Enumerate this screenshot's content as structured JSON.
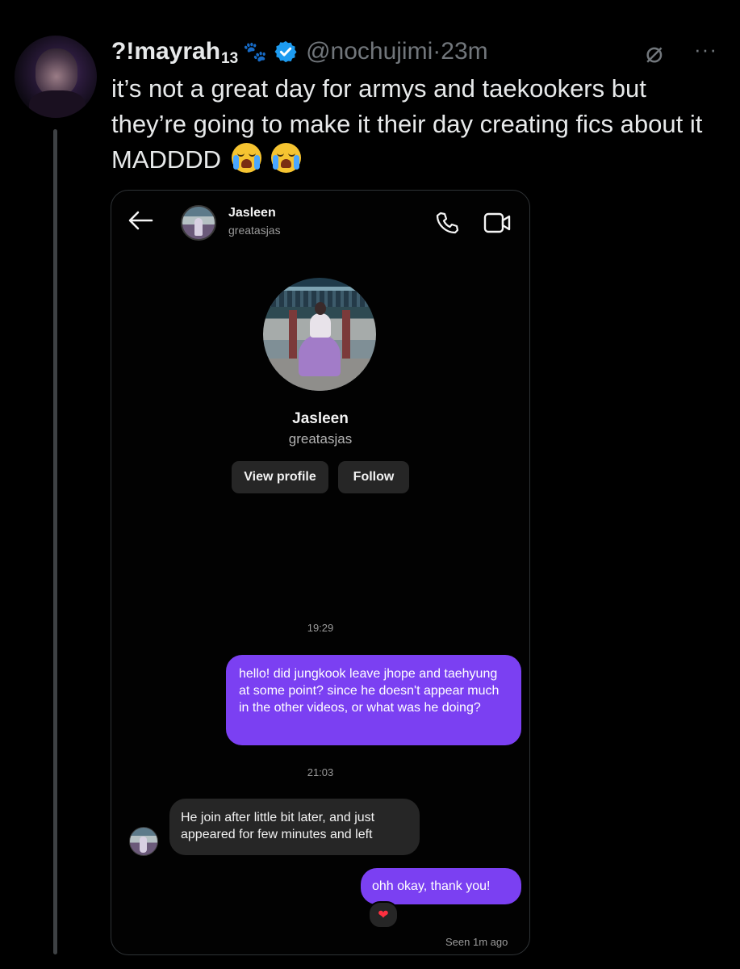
{
  "tweet": {
    "display_name": "?!mayrah",
    "display_name_sub": "13",
    "paw_glyph": "🐾",
    "handle": "@nochujimi",
    "separator": "·",
    "time": "23m",
    "grok_glyph": "⌀",
    "more_glyph": "···",
    "text": "it’s not a great day for armys and taekookers but they’re going to make it their day creating fics about it MADDDD",
    "emoji_names": [
      "loudly-crying-face",
      "loudly-crying-face"
    ],
    "verified_color": "#1d9bf0"
  },
  "screenshot": {
    "header": {
      "name": "Jasleen",
      "username": "greatasjas"
    },
    "profile": {
      "name": "Jasleen",
      "username": "greatasjas",
      "view_profile_label": "View profile",
      "follow_label": "Follow"
    },
    "messages": [
      {
        "type": "timestamp",
        "text": "19:29"
      },
      {
        "type": "outgoing",
        "text": "hello! did jungkook leave jhope and taehyung at some point? since he doesn't appear much in the other videos, or what was he doing?"
      },
      {
        "type": "timestamp",
        "text": "21:03"
      },
      {
        "type": "incoming",
        "text": "He join after little bit later, and just appeared for few minutes and left"
      },
      {
        "type": "outgoing",
        "text": "ohh okay, thank you!"
      }
    ],
    "reaction": "❤",
    "seen_text": "Seen 1m ago",
    "colors": {
      "outgoing_bubble": "#7b40f2",
      "incoming_bubble": "#262626"
    }
  }
}
